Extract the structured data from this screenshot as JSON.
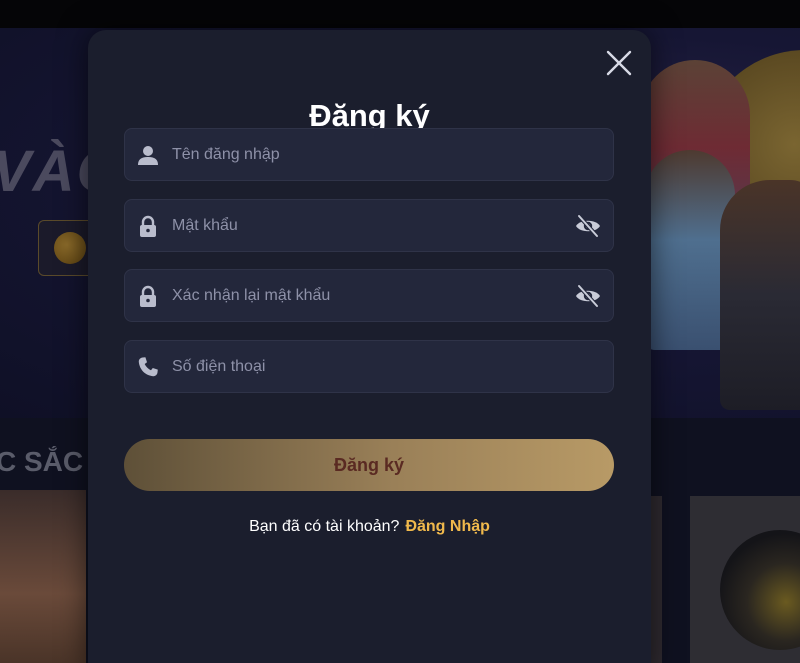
{
  "background": {
    "banner_text": "VÀO",
    "section_title": "C SẮC"
  },
  "modal": {
    "title": "Đăng ký",
    "close_icon": "close-icon",
    "fields": {
      "username": {
        "placeholder": "Tên đăng nhập",
        "value": "",
        "icon": "user-icon"
      },
      "password": {
        "placeholder": "Mật khẩu",
        "value": "",
        "icon": "lock-icon",
        "toggle_icon": "eye-slash-icon"
      },
      "confirm_password": {
        "placeholder": "Xác nhận lại mật khẩu",
        "value": "",
        "icon": "lock-icon",
        "toggle_icon": "eye-slash-icon"
      },
      "phone": {
        "placeholder": "Số điện thoại",
        "value": "",
        "icon": "phone-icon"
      }
    },
    "submit_label": "Đăng ký",
    "footer": {
      "prompt": "Bạn đã có tài khoản?",
      "login_link": "Đăng Nhập"
    }
  },
  "colors": {
    "modal_bg": "#1b1e2d",
    "field_bg": "#23273b",
    "placeholder": "#8e91a8",
    "link_accent": "#f0b94c",
    "button_text": "#5a2a22"
  }
}
